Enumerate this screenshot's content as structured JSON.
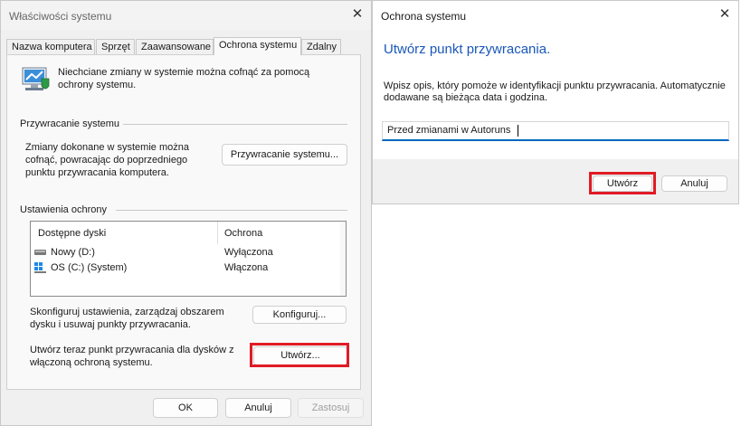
{
  "props": {
    "title": "Właściwości systemu",
    "tabs": [
      "Nazwa komputera",
      "Sprzęt",
      "Zaawansowane",
      "Ochrona systemu",
      "Zdalny"
    ],
    "intro": "Niechciane zmiany w systemie można cofnąć za pomocą ochrony systemu.",
    "restore_section": "Przywracanie systemu",
    "restore_desc": "Zmiany dokonane w systemie można cofnąć, powracając do poprzedniego punktu przywracania komputera.",
    "restore_button": "Przywracanie systemu...",
    "settings_section": "Ustawienia ochrony",
    "columns": [
      "Dostępne dyski",
      "Ochrona"
    ],
    "drives": [
      {
        "name": "Nowy (D:)",
        "status": "Wyłączona",
        "icon": "drive-icon"
      },
      {
        "name": "OS (C:) (System)",
        "status": "Włączona",
        "icon": "windows-drive-icon"
      }
    ],
    "configure_desc": "Skonfiguruj ustawienia, zarządzaj obszarem dysku i usuwaj punkty przywracania.",
    "configure_button": "Konfiguruj...",
    "create_desc": "Utwórz teraz punkt przywracania dla dysków z włączoną ochroną systemu.",
    "create_button": "Utwórz...",
    "ok": "OK",
    "cancel": "Anuluj",
    "apply": "Zastosuj"
  },
  "dialog": {
    "title": "Ochrona systemu",
    "heading": "Utwórz punkt przywracania.",
    "desc": "Wpisz opis, który pomoże w identyfikacji punktu przywracania. Automatycznie dodawane są bieżąca data i godzina.",
    "input_value": "Przed zmianami w Autoruns",
    "create_button": "Utwórz",
    "cancel_button": "Anuluj"
  },
  "colors": {
    "highlight": "#e01b24",
    "heading_blue": "#1a57b8",
    "input_underline": "#0067c0"
  }
}
